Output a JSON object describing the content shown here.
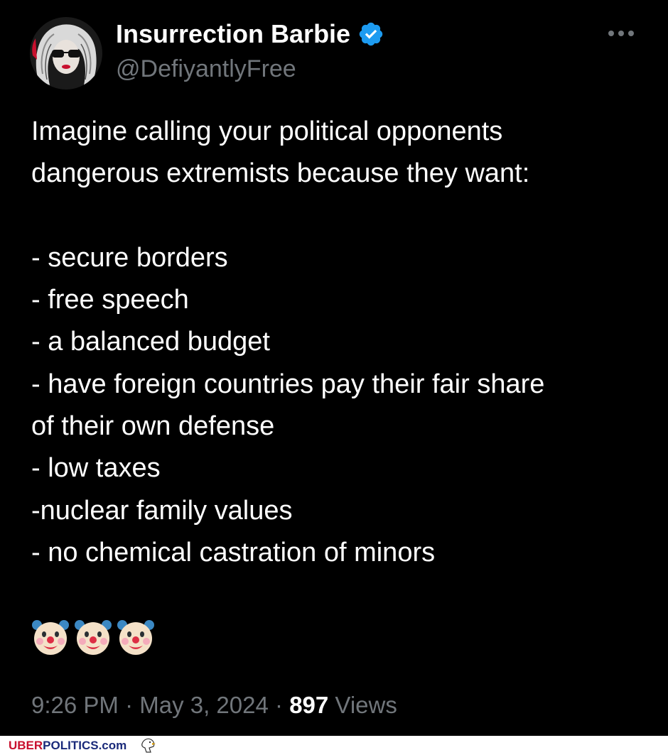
{
  "author": {
    "name": "Insurrection Barbie",
    "handle": "@DefiyantlyFree",
    "verified": true,
    "verified_color": "#1d9bf0",
    "avatar_icon": "woman-sunglasses-avatar"
  },
  "more_icon": "more-horizontal-icon",
  "tweet": {
    "line1": "Imagine calling your political opponents",
    "line2": "dangerous extremists because they want:",
    "items": [
      "- secure borders",
      "- free speech",
      "- a balanced budget",
      "- have foreign countries pay their fair share",
      "of their own defense",
      "- low taxes",
      "-nuclear family values",
      "- no chemical castration of minors"
    ],
    "emoji": [
      "clown-face-icon",
      "clown-face-icon",
      "clown-face-icon"
    ]
  },
  "meta": {
    "time": "9:26 PM",
    "sep1": " · ",
    "date": "May 3, 2024",
    "sep2": " · ",
    "views_count": "897",
    "views_label": " Views"
  },
  "watermark": {
    "part1": "UBER",
    "part2": "POLITICS",
    "part3": ".com",
    "icon": "eagle-icon"
  },
  "colors": {
    "background": "#000000",
    "text": "#ffffff",
    "muted": "#71767b",
    "verified": "#1d9bf0"
  }
}
